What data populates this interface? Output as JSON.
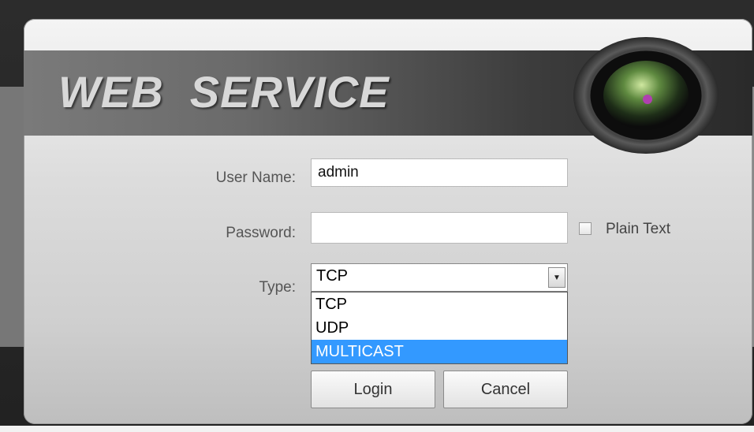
{
  "banner": {
    "title": "WEB  SERVICE"
  },
  "form": {
    "username_label": "User Name:",
    "username_value": "admin",
    "password_label": "Password:",
    "password_value": "",
    "plain_text_label": "Plain Text",
    "plain_text_checked": false,
    "type_label": "Type:",
    "type_selected": "TCP",
    "type_options": [
      "TCP",
      "UDP",
      "MULTICAST"
    ],
    "type_highlighted": "MULTICAST"
  },
  "buttons": {
    "login": "Login",
    "cancel": "Cancel"
  },
  "colors": {
    "highlight": "#3399ff",
    "banner_dark": "#2a2a2a"
  },
  "icons": {
    "camera": "camera-lens-icon",
    "dropdown_arrow": "chevron-down-icon"
  }
}
